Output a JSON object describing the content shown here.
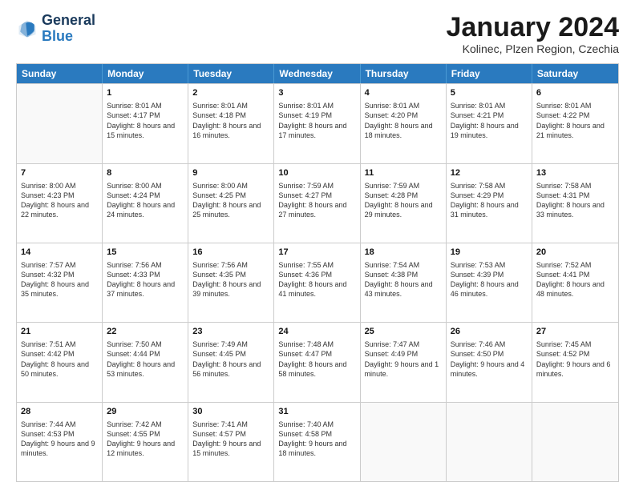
{
  "logo": {
    "line1": "General",
    "line2": "Blue"
  },
  "title": "January 2024",
  "subtitle": "Kolinec, Plzen Region, Czechia",
  "header_days": [
    "Sunday",
    "Monday",
    "Tuesday",
    "Wednesday",
    "Thursday",
    "Friday",
    "Saturday"
  ],
  "rows": [
    [
      {
        "day": "",
        "sunrise": "",
        "sunset": "",
        "daylight": "",
        "empty": true
      },
      {
        "day": "1",
        "sunrise": "Sunrise: 8:01 AM",
        "sunset": "Sunset: 4:17 PM",
        "daylight": "Daylight: 8 hours and 15 minutes."
      },
      {
        "day": "2",
        "sunrise": "Sunrise: 8:01 AM",
        "sunset": "Sunset: 4:18 PM",
        "daylight": "Daylight: 8 hours and 16 minutes."
      },
      {
        "day": "3",
        "sunrise": "Sunrise: 8:01 AM",
        "sunset": "Sunset: 4:19 PM",
        "daylight": "Daylight: 8 hours and 17 minutes."
      },
      {
        "day": "4",
        "sunrise": "Sunrise: 8:01 AM",
        "sunset": "Sunset: 4:20 PM",
        "daylight": "Daylight: 8 hours and 18 minutes."
      },
      {
        "day": "5",
        "sunrise": "Sunrise: 8:01 AM",
        "sunset": "Sunset: 4:21 PM",
        "daylight": "Daylight: 8 hours and 19 minutes."
      },
      {
        "day": "6",
        "sunrise": "Sunrise: 8:01 AM",
        "sunset": "Sunset: 4:22 PM",
        "daylight": "Daylight: 8 hours and 21 minutes."
      }
    ],
    [
      {
        "day": "7",
        "sunrise": "Sunrise: 8:00 AM",
        "sunset": "Sunset: 4:23 PM",
        "daylight": "Daylight: 8 hours and 22 minutes."
      },
      {
        "day": "8",
        "sunrise": "Sunrise: 8:00 AM",
        "sunset": "Sunset: 4:24 PM",
        "daylight": "Daylight: 8 hours and 24 minutes."
      },
      {
        "day": "9",
        "sunrise": "Sunrise: 8:00 AM",
        "sunset": "Sunset: 4:25 PM",
        "daylight": "Daylight: 8 hours and 25 minutes."
      },
      {
        "day": "10",
        "sunrise": "Sunrise: 7:59 AM",
        "sunset": "Sunset: 4:27 PM",
        "daylight": "Daylight: 8 hours and 27 minutes."
      },
      {
        "day": "11",
        "sunrise": "Sunrise: 7:59 AM",
        "sunset": "Sunset: 4:28 PM",
        "daylight": "Daylight: 8 hours and 29 minutes."
      },
      {
        "day": "12",
        "sunrise": "Sunrise: 7:58 AM",
        "sunset": "Sunset: 4:29 PM",
        "daylight": "Daylight: 8 hours and 31 minutes."
      },
      {
        "day": "13",
        "sunrise": "Sunrise: 7:58 AM",
        "sunset": "Sunset: 4:31 PM",
        "daylight": "Daylight: 8 hours and 33 minutes."
      }
    ],
    [
      {
        "day": "14",
        "sunrise": "Sunrise: 7:57 AM",
        "sunset": "Sunset: 4:32 PM",
        "daylight": "Daylight: 8 hours and 35 minutes."
      },
      {
        "day": "15",
        "sunrise": "Sunrise: 7:56 AM",
        "sunset": "Sunset: 4:33 PM",
        "daylight": "Daylight: 8 hours and 37 minutes."
      },
      {
        "day": "16",
        "sunrise": "Sunrise: 7:56 AM",
        "sunset": "Sunset: 4:35 PM",
        "daylight": "Daylight: 8 hours and 39 minutes."
      },
      {
        "day": "17",
        "sunrise": "Sunrise: 7:55 AM",
        "sunset": "Sunset: 4:36 PM",
        "daylight": "Daylight: 8 hours and 41 minutes."
      },
      {
        "day": "18",
        "sunrise": "Sunrise: 7:54 AM",
        "sunset": "Sunset: 4:38 PM",
        "daylight": "Daylight: 8 hours and 43 minutes."
      },
      {
        "day": "19",
        "sunrise": "Sunrise: 7:53 AM",
        "sunset": "Sunset: 4:39 PM",
        "daylight": "Daylight: 8 hours and 46 minutes."
      },
      {
        "day": "20",
        "sunrise": "Sunrise: 7:52 AM",
        "sunset": "Sunset: 4:41 PM",
        "daylight": "Daylight: 8 hours and 48 minutes."
      }
    ],
    [
      {
        "day": "21",
        "sunrise": "Sunrise: 7:51 AM",
        "sunset": "Sunset: 4:42 PM",
        "daylight": "Daylight: 8 hours and 50 minutes."
      },
      {
        "day": "22",
        "sunrise": "Sunrise: 7:50 AM",
        "sunset": "Sunset: 4:44 PM",
        "daylight": "Daylight: 8 hours and 53 minutes."
      },
      {
        "day": "23",
        "sunrise": "Sunrise: 7:49 AM",
        "sunset": "Sunset: 4:45 PM",
        "daylight": "Daylight: 8 hours and 56 minutes."
      },
      {
        "day": "24",
        "sunrise": "Sunrise: 7:48 AM",
        "sunset": "Sunset: 4:47 PM",
        "daylight": "Daylight: 8 hours and 58 minutes."
      },
      {
        "day": "25",
        "sunrise": "Sunrise: 7:47 AM",
        "sunset": "Sunset: 4:49 PM",
        "daylight": "Daylight: 9 hours and 1 minute."
      },
      {
        "day": "26",
        "sunrise": "Sunrise: 7:46 AM",
        "sunset": "Sunset: 4:50 PM",
        "daylight": "Daylight: 9 hours and 4 minutes."
      },
      {
        "day": "27",
        "sunrise": "Sunrise: 7:45 AM",
        "sunset": "Sunset: 4:52 PM",
        "daylight": "Daylight: 9 hours and 6 minutes."
      }
    ],
    [
      {
        "day": "28",
        "sunrise": "Sunrise: 7:44 AM",
        "sunset": "Sunset: 4:53 PM",
        "daylight": "Daylight: 9 hours and 9 minutes."
      },
      {
        "day": "29",
        "sunrise": "Sunrise: 7:42 AM",
        "sunset": "Sunset: 4:55 PM",
        "daylight": "Daylight: 9 hours and 12 minutes."
      },
      {
        "day": "30",
        "sunrise": "Sunrise: 7:41 AM",
        "sunset": "Sunset: 4:57 PM",
        "daylight": "Daylight: 9 hours and 15 minutes."
      },
      {
        "day": "31",
        "sunrise": "Sunrise: 7:40 AM",
        "sunset": "Sunset: 4:58 PM",
        "daylight": "Daylight: 9 hours and 18 minutes."
      },
      {
        "day": "",
        "sunrise": "",
        "sunset": "",
        "daylight": "",
        "empty": true
      },
      {
        "day": "",
        "sunrise": "",
        "sunset": "",
        "daylight": "",
        "empty": true
      },
      {
        "day": "",
        "sunrise": "",
        "sunset": "",
        "daylight": "",
        "empty": true
      }
    ]
  ]
}
